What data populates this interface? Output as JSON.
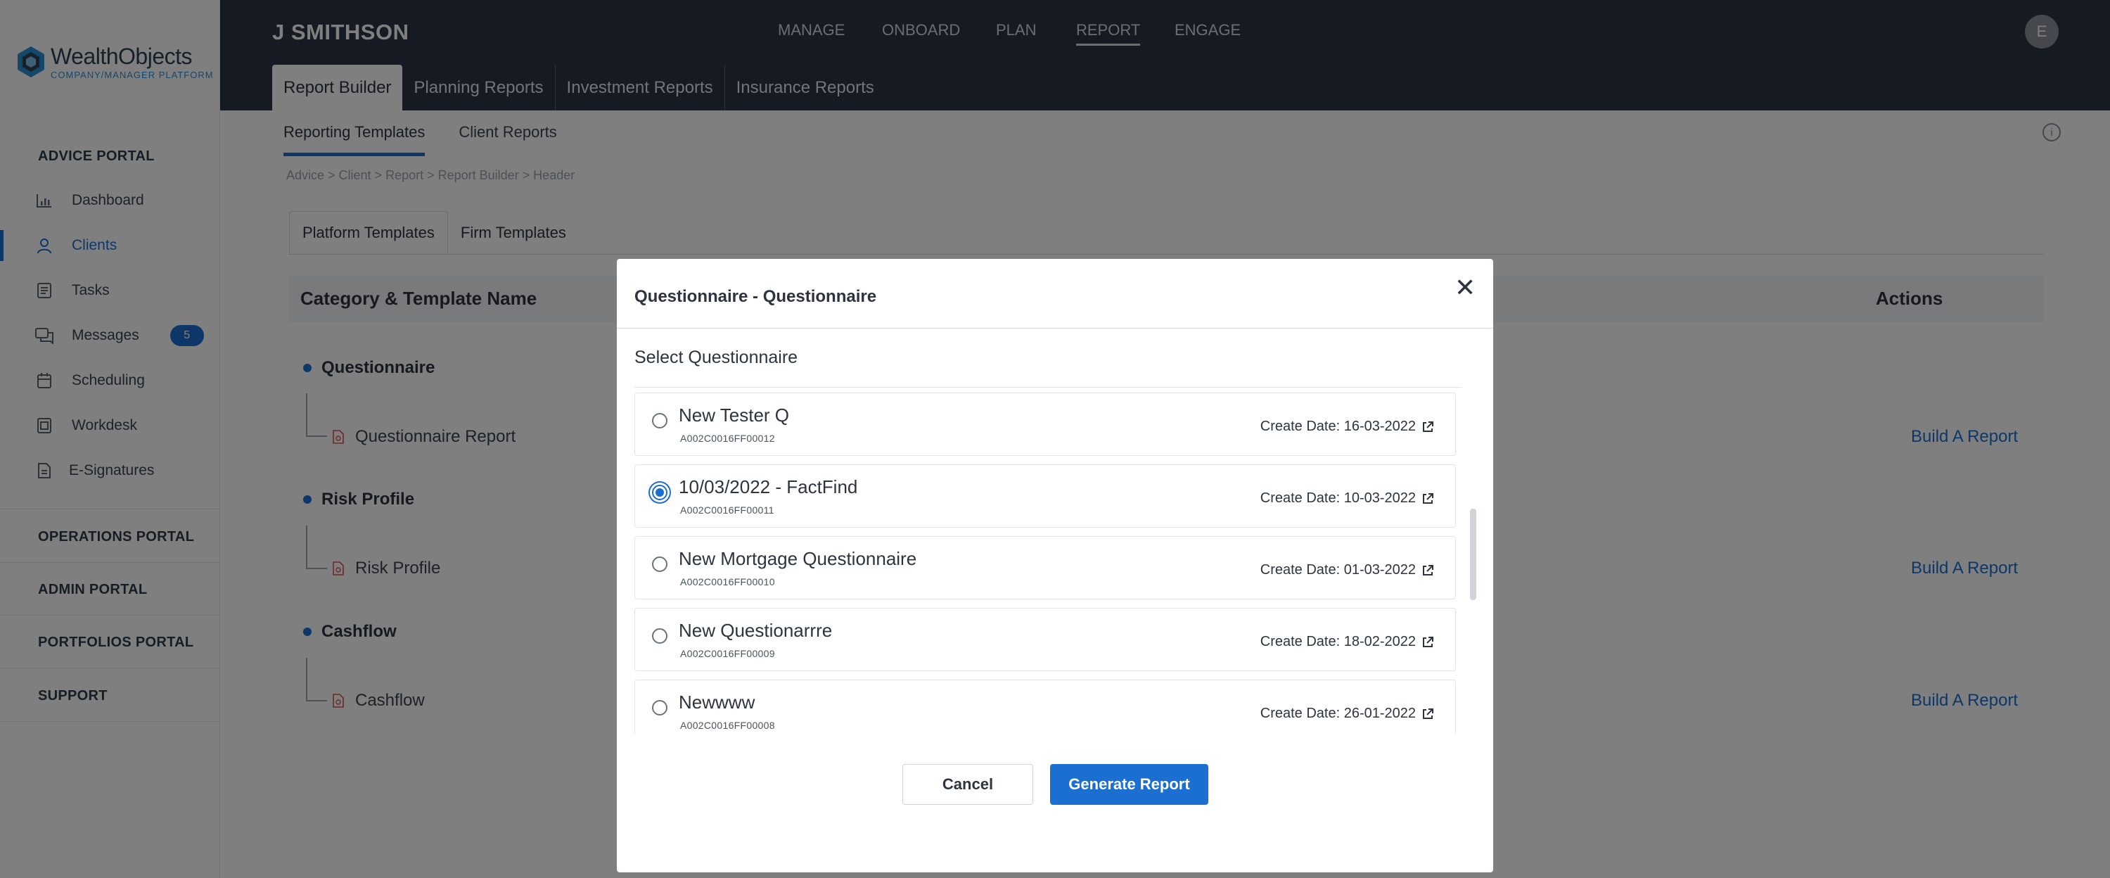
{
  "app": {
    "logo_name": "WealthObjects",
    "logo_sub": "COMPANY/MANAGER PLATFORM",
    "brand_color": "#1a6fd1"
  },
  "sidebar": {
    "sections": {
      "advice": "ADVICE PORTAL",
      "operations": "OPERATIONS PORTAL",
      "admin": "ADMIN PORTAL",
      "portfolios": "PORTFOLIOS PORTAL",
      "support": "SUPPORT"
    },
    "items": [
      {
        "label": "Dashboard",
        "icon": "chart-icon"
      },
      {
        "label": "Clients",
        "icon": "user-icon",
        "active": true
      },
      {
        "label": "Tasks",
        "icon": "tasks-icon"
      },
      {
        "label": "Messages",
        "icon": "messages-icon",
        "badge": "5"
      },
      {
        "label": "Scheduling",
        "icon": "calendar-icon"
      },
      {
        "label": "Workdesk",
        "icon": "workdesk-icon"
      },
      {
        "label": "E-Signatures",
        "icon": "document-icon"
      }
    ]
  },
  "header": {
    "client_name": "J SMITHSON",
    "nav": [
      "MANAGE",
      "ONBOARD",
      "PLAN",
      "REPORT",
      "ENGAGE"
    ],
    "active_nav": "REPORT",
    "avatar_initial": "E",
    "subtabs": [
      "Report Builder",
      "Planning Reports",
      "Investment Reports",
      "Insurance Reports"
    ]
  },
  "main": {
    "tabs": [
      "Reporting Templates",
      "Client Reports"
    ],
    "breadcrumb": "Advice  >  Client  >  Report  >  Report Builder  >  Header",
    "template_tabs": [
      "Platform Templates",
      "Firm Templates"
    ],
    "columns": {
      "name": "Category & Template Name",
      "actions": "Actions"
    },
    "categories": [
      {
        "name": "Questionnaire",
        "template": "Questionnaire Report",
        "action": "Build A Report"
      },
      {
        "name": "Risk Profile",
        "template": "Risk Profile",
        "action": "Build A Report"
      },
      {
        "name": "Cashflow",
        "template": "Cashflow",
        "action": "Build A Report"
      }
    ]
  },
  "modal": {
    "title": "Questionnaire - Questionnaire",
    "close": "✕",
    "select_label": "Select Questionnaire",
    "items": [
      {
        "name": "New Tester Q",
        "id": "A002C0016FF00012",
        "date": "Create Date: 16-03-2022",
        "checked": false
      },
      {
        "name": "10/03/2022 - FactFind",
        "id": "A002C0016FF00011",
        "date": "Create Date: 10-03-2022",
        "checked": true
      },
      {
        "name": "New Mortgage Questionnaire",
        "id": "A002C0016FF00010",
        "date": "Create Date: 01-03-2022",
        "checked": false
      },
      {
        "name": "New Questionarrre",
        "id": "A002C0016FF00009",
        "date": "Create Date: 18-02-2022",
        "checked": false
      },
      {
        "name": "Newwww",
        "id": "A002C0016FF00008",
        "date": "Create Date: 26-01-2022",
        "checked": false
      }
    ],
    "cancel_label": "Cancel",
    "generate_label": "Generate Report"
  }
}
